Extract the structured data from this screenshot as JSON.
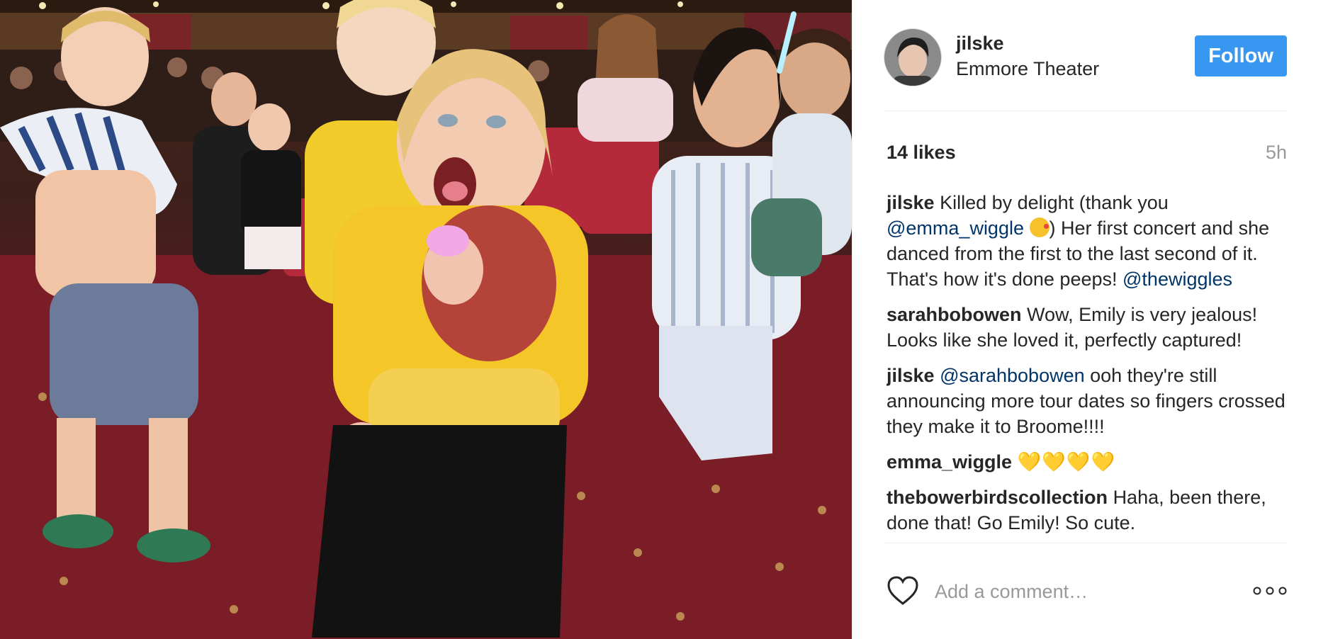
{
  "post": {
    "username": "jilske",
    "location": "Emmore Theater",
    "follow_label": "Follow",
    "likes": "14 likes",
    "time": "5h"
  },
  "comments": [
    {
      "user": "jilske",
      "t1": "Killed by delight (thank you ",
      "m1": "@emma_wiggle",
      "t2": ") Her first concert and she danced from the first to the last second of it. That's how it's done peeps! ",
      "m2": "@thewiggles"
    },
    {
      "user": "sarahbobowen",
      "t1": "Wow, Emily is very jealous! Looks like she loved it, perfectly captured!"
    },
    {
      "user": "jilske",
      "m1": "@sarahbobowen",
      "t1": " ooh they're still announcing more tour dates so fingers crossed they make it to Broome!!!!"
    },
    {
      "user": "emma_wiggle",
      "hearts": "💛💛💛💛"
    },
    {
      "user": "thebowerbirdscollection",
      "t1": "Haha, been there, done that! Go Emily! So cute."
    }
  ],
  "add_comment_placeholder": "Add a comment…",
  "icons": {
    "heart": "heart-icon",
    "more": "more-options-icon",
    "kiss": "kiss-emoji-icon"
  },
  "colors": {
    "follow_bg": "#3897f0",
    "mention": "#003569",
    "muted": "#999999"
  }
}
